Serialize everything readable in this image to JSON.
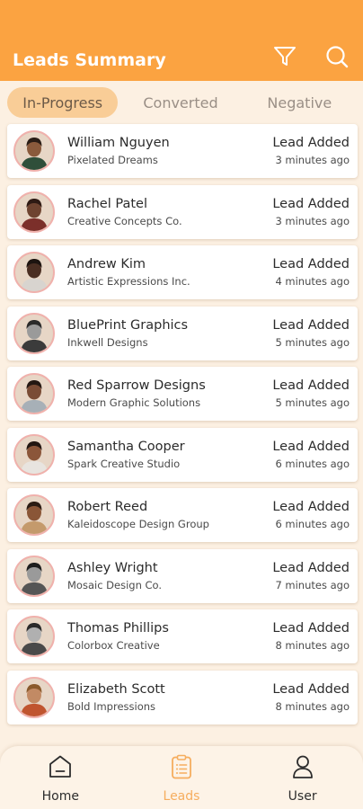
{
  "header": {
    "title": "Leads Summary",
    "filter_icon": "filter-icon",
    "search_icon": "search-icon"
  },
  "tabs": [
    {
      "label": "In-Progress",
      "active": true
    },
    {
      "label": "Converted",
      "active": false
    },
    {
      "label": "Negative",
      "active": false
    }
  ],
  "leads": [
    {
      "name": "William Nguyen",
      "company": "Pixelated Dreams",
      "status": "Lead Added",
      "time": "3 minutes ago",
      "skin": "#8a5a3c",
      "hair": "#2a1d16",
      "shirt": "#2f4f3a"
    },
    {
      "name": "Rachel Patel",
      "company": "Creative Concepts Co.",
      "status": "Lead Added",
      "time": "3 minutes ago",
      "skin": "#6e4330",
      "hair": "#2e1a14",
      "shirt": "#7b2f2a"
    },
    {
      "name": "Andrew Kim",
      "company": "Artistic Expressions Inc.",
      "status": "Lead Added",
      "time": "4 minutes ago",
      "skin": "#4a2e22",
      "hair": "#1d1410",
      "shirt": "#d8d4cf"
    },
    {
      "name": "BluePrint Graphics",
      "company": "Inkwell Designs",
      "status": "Lead Added",
      "time": "5 minutes ago",
      "skin": "#9a9a9a",
      "hair": "#2a2a2a",
      "shirt": "#3b3b3b"
    },
    {
      "name": "Red Sparrow Designs",
      "company": "Modern Graphic Solutions",
      "status": "Lead Added",
      "time": "5 minutes ago",
      "skin": "#7a4c35",
      "hair": "#231812",
      "shirt": "#a7b0b7"
    },
    {
      "name": "Samantha Cooper",
      "company": "Spark Creative Studio",
      "status": "Lead Added",
      "time": "6 minutes ago",
      "skin": "#8b563a",
      "hair": "#221611",
      "shirt": "#e8e4df"
    },
    {
      "name": "Robert Reed",
      "company": "Kaleidoscope Design Group",
      "status": "Lead Added",
      "time": "6 minutes ago",
      "skin": "#8a5637",
      "hair": "#2b1c13",
      "shirt": "#c49a6c"
    },
    {
      "name": "Ashley Wright",
      "company": "Mosaic Design Co.",
      "status": "Lead Added",
      "time": "7 minutes ago",
      "skin": "#9a9a9a",
      "hair": "#1e1e1e",
      "shirt": "#555555"
    },
    {
      "name": "Thomas Phillips",
      "company": "Colorbox Creative",
      "status": "Lead Added",
      "time": "8 minutes ago",
      "skin": "#b0b0b0",
      "hair": "#2a2a2a",
      "shirt": "#4a4a4a"
    },
    {
      "name": "Elizabeth Scott",
      "company": "Bold Impressions",
      "status": "Lead Added",
      "time": "8 minutes ago",
      "skin": "#c28a64",
      "hair": "#8a5a2c",
      "shirt": "#c0552f"
    }
  ],
  "bottom_nav": [
    {
      "label": "Home",
      "icon": "home-icon",
      "active": false
    },
    {
      "label": "Leads",
      "icon": "clipboard-icon",
      "active": true
    },
    {
      "label": "User",
      "icon": "user-icon",
      "active": false
    }
  ],
  "colors": {
    "header_bg": "#fba341",
    "active_tab_bg": "#f9cd97",
    "active_nav": "#f6ad5e",
    "page_bg": "#fcf0e2"
  }
}
